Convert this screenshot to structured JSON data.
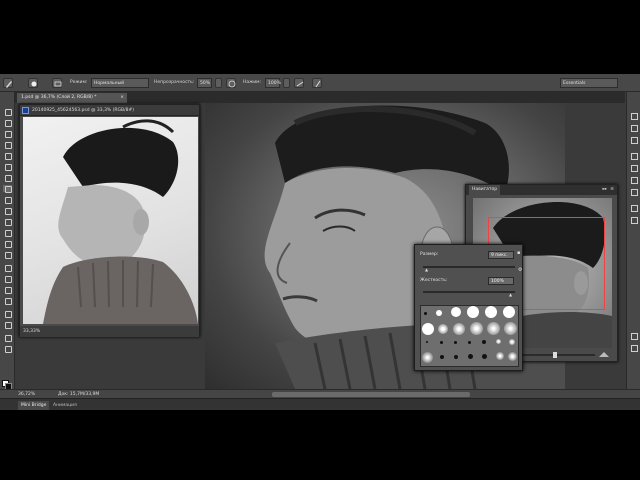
{
  "options_bar": {
    "mode_label": "Режим:",
    "mode_value": "Нормальный",
    "opacity_label": "Непрозрачность:",
    "opacity_value": "50%",
    "flow_label": "Нажим:",
    "flow_value": "100%",
    "workspace_value": "Essentials"
  },
  "document_tab": {
    "title": "1.psd @ 36,7% (Слой 2, RGB/8) *",
    "close_icon": "close-icon"
  },
  "floating_window": {
    "title": "20140925_45624563.psd @ 33,3% (RGB/8#)",
    "zoom": "33,33%"
  },
  "status": {
    "zoom": "36,72%",
    "doc_size": "Док: 15,7M/33,9M"
  },
  "navigator": {
    "tab_label": "Навигатор"
  },
  "brush_picker": {
    "size_label": "Размер:",
    "size_value": "9 пикс.",
    "hardness_label": "Жесткость:",
    "hardness_value": "100%",
    "brush_sizes": [
      "1",
      "3",
      "5",
      "9",
      "13",
      "19",
      "5",
      "9",
      "13",
      "17",
      "21",
      "27",
      "35",
      "45"
    ]
  },
  "bottom_tabs": {
    "mini_bridge": "Mini Bridge",
    "animation": "Анимация"
  },
  "icons": {
    "brush_tool": "brush-icon",
    "airbrush": "airbrush-icon",
    "pressure": "pressure-icon",
    "move_tool": "move-icon",
    "marquee_tool": "marquee-icon",
    "lasso_tool": "lasso-icon",
    "crop_tool": "crop-icon",
    "eyedropper_tool": "eyedropper-icon",
    "zoom_tool": "zoom-icon",
    "hand_tool": "hand-icon"
  },
  "colors": {
    "navigator_box": "#e44444",
    "foreground": "#ffffff",
    "background": "#111111"
  }
}
